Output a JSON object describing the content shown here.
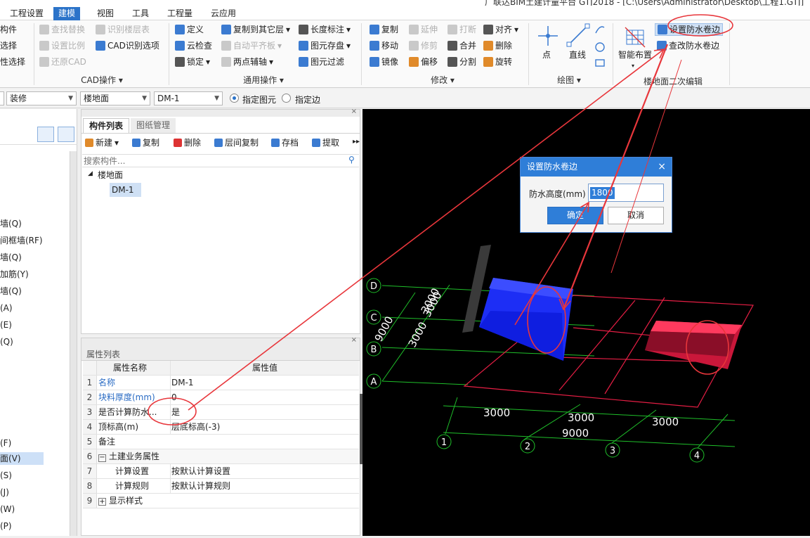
{
  "window": {
    "title_partial": "广联达BIM土建计量平台 GTJ2018 - [C:\\Users\\Administrator\\Desktop\\工程1.GTJ]"
  },
  "menu": [
    "工程设置",
    "建模",
    "视图",
    "工具",
    "工程量",
    "云应用"
  ],
  "ribbon": {
    "col0": [
      "构件",
      "选择",
      "性选择"
    ],
    "cad": {
      "items": [
        "查找替换",
        "识别楼层表",
        "设置比例",
        "CAD识别选项",
        "还原CAD"
      ],
      "label": "CAD操作"
    },
    "common": {
      "items": [
        "定义",
        "复制到其它层",
        "长度标注",
        "云检查",
        "自动平齐板",
        "图元存盘",
        "锁定",
        "两点辅轴",
        "图元过滤"
      ],
      "label": "通用操作"
    },
    "modify": {
      "items": [
        "复制",
        "延伸",
        "打断",
        "对齐",
        "移动",
        "修剪",
        "合并",
        "删除",
        "镜像",
        "偏移",
        "分割",
        "旋转"
      ],
      "label": "修改"
    },
    "draw": {
      "items": [
        "点",
        "直线"
      ],
      "label": "绘图"
    },
    "floor2": {
      "items": [
        "智能布置",
        "设置防水卷边",
        "查改防水卷边"
      ],
      "label": "楼地面二次编辑"
    }
  },
  "toolbar2": {
    "combo1": "装修",
    "combo2": "楼地面",
    "combo3": "DM-1",
    "radio1": "指定图元",
    "radio2": "指定边"
  },
  "left_list": [
    "墙(Q)",
    "间框墙(RF)",
    "墙(Q)",
    "加筋(Y)",
    "墙(Q)",
    "(A)",
    "(E)",
    "(Q)",
    "(F)",
    "面(V)",
    "(S)",
    "(J)",
    "(W)",
    "(P)"
  ],
  "component_panel": {
    "tabs": [
      "构件列表",
      "图纸管理"
    ],
    "toolbar": [
      "新建",
      "复制",
      "删除",
      "层间复制",
      "存档",
      "提取"
    ],
    "search_placeholder": "搜索构件...",
    "tree_root": "楼地面",
    "tree_child": "DM-1"
  },
  "property_panel": {
    "title": "属性列表",
    "headers": [
      "属性名称",
      "属性值"
    ],
    "rows": [
      {
        "n": "1",
        "k": "名称",
        "v": "DM-1"
      },
      {
        "n": "2",
        "k": "块料厚度(mm)",
        "v": "0"
      },
      {
        "n": "3",
        "k": "是否计算防水...",
        "v": "是"
      },
      {
        "n": "4",
        "k": "顶标高(m)",
        "v": "层底标高(-3)"
      },
      {
        "n": "5",
        "k": "备注",
        "v": ""
      },
      {
        "n": "6",
        "k": "土建业务属性",
        "v": ""
      },
      {
        "n": "7",
        "k": "计算设置",
        "v": "按默认计算设置"
      },
      {
        "n": "8",
        "k": "计算规则",
        "v": "按默认计算规则"
      },
      {
        "n": "9",
        "k": "显示样式",
        "v": ""
      }
    ]
  },
  "dialog": {
    "title": "设置防水卷边",
    "label": "防水高度(mm)",
    "value": "1800",
    "ok": "确定",
    "cancel": "取消",
    "close": "×"
  },
  "drawing": {
    "axis_rows": [
      "D",
      "C",
      "B",
      "A"
    ],
    "axis_cols": [
      "1",
      "2",
      "3",
      "4"
    ],
    "dims": [
      "3000",
      "3000",
      "3000",
      "9000",
      "3000",
      "3000",
      "3000",
      "9000"
    ],
    "colors": {
      "grid": "#1fbf2a",
      "slab": "#e51e44",
      "blue_box": "#1d2ef5",
      "annotation": "#e8363b",
      "accent": "#2b73c9"
    }
  }
}
